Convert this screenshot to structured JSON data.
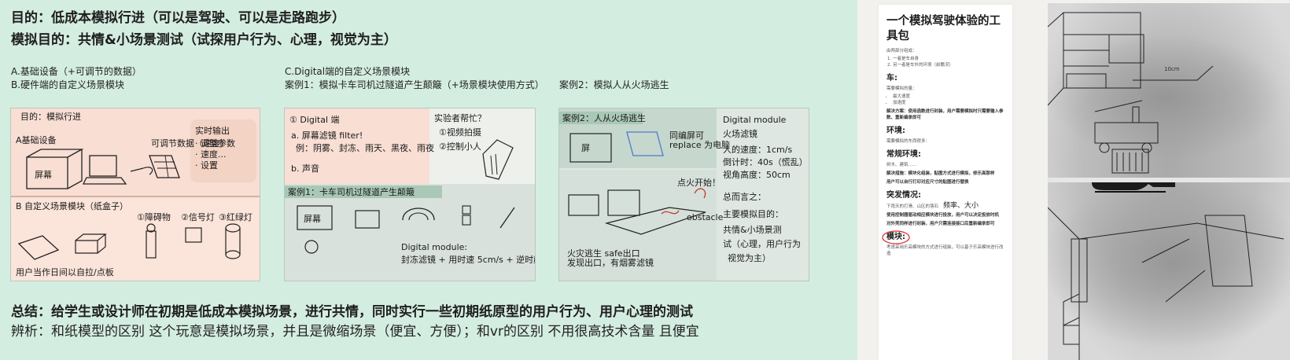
{
  "board": {
    "goal_line1": "目的：低成本模拟行进（可以是驾驶、可以是走路跑步）",
    "goal_line2": "模拟目的：共情&小场景测试（试探用户行为、心理，视觉为主）",
    "col1_line1": "A.基础设备（+可调节的数据）",
    "col1_line2": "B.硬件端的自定义场景模块",
    "col2_line1": "C.Digital端的自定义场景模块",
    "col2_line2": "案例1：模拟卡车司机过隧道产生颠簸（+场景模块使用方式）",
    "col3_line1": "案例2：模拟人从火场逃生",
    "summary": "总结：给学生或设计师在初期是低成本模拟场景，进行共情，同时实行一些初期纸原型的用户行为、用户心理的测试",
    "analysis": "辨析：和纸模型的区别 这个玩意是模拟场景，并且是微缩场景（便宜、方便）；和vr的区别 不用很高技术含量 且便宜"
  },
  "sketch1": {
    "title": "目的：模拟行进",
    "notes": [
      "A基础设备",
      "B 自定义场景模块（纸盒子）",
      "可调节数据（速度）",
      "①障碍物",
      "②信号灯",
      "③红绿灯",
      "用户"
    ]
  },
  "sketch2": {
    "notes": [
      "① Digital 端",
      "a. 屏幕滤镜 filter!",
      "例：阴雾、封冻、雨天、黑夜、雨夜",
      "b. 声音",
      "实验者帮忙？",
      "①视频拍摄",
      "②控制小人",
      "案例1：卡车司机过隧道产生颠簸",
      "屏幕",
      "Digital module:",
      "封冻滤镜 + 用时速 5cm/s + 逆时颠簸"
    ]
  },
  "sketch3": {
    "notes": [
      "案例2：人从火场逃生",
      "Digital module",
      "火场滤镜",
      "人的速度：1cm/s",
      "倒计时：40s（慌乱）",
      "视角高度：50cm",
      "点火开始！",
      "obstacle",
      "总而言之：",
      "主要模拟目的：",
      "共情&小场景测",
      "试（心理，用户行为",
      "视觉为主）"
    ]
  },
  "doc": {
    "title": "一个模拟驾驶体验的工具包",
    "intro": "由两部分组成：",
    "parts": [
      "一者是车自身",
      "另一者是车外的环境（前瞻况）"
    ],
    "car_heading": "车:",
    "car_text": "需要模拟的量：",
    "car_items": [
      "最大速度",
      "加速度"
    ],
    "car_solution": "解决方案：使用函数进行封装，用户需要模拟时只需要输入参数、重新编录即可",
    "env_heading": "环境:",
    "env_text": "需要模拟的东西很多：",
    "regular_heading": "常规环境:",
    "regular_text": "树木、建筑……",
    "regular_solution": "解决措施：模块化组装，贴图方式进行模拟，修乐高那样",
    "regular_note": "用户可以自行打印对应尺寸的贴图进行替换",
    "emerg_heading": "突发情况:",
    "emerg_text": "下雨天的打滑、山区的落石",
    "emerg_big": "频率、大小",
    "emerg_solution": "使用控制器驱动相应模块进行投放，用户可以决定投放时机",
    "emerg_note": "对外壳同样进行封装，用户只需连接接口后重新编录即可",
    "module_heading": "模块:",
    "module_text": "考虑采用乐高模块的方式进行组装，可以基于乐高模块进行改造"
  },
  "photo": {
    "label": "10cm"
  }
}
